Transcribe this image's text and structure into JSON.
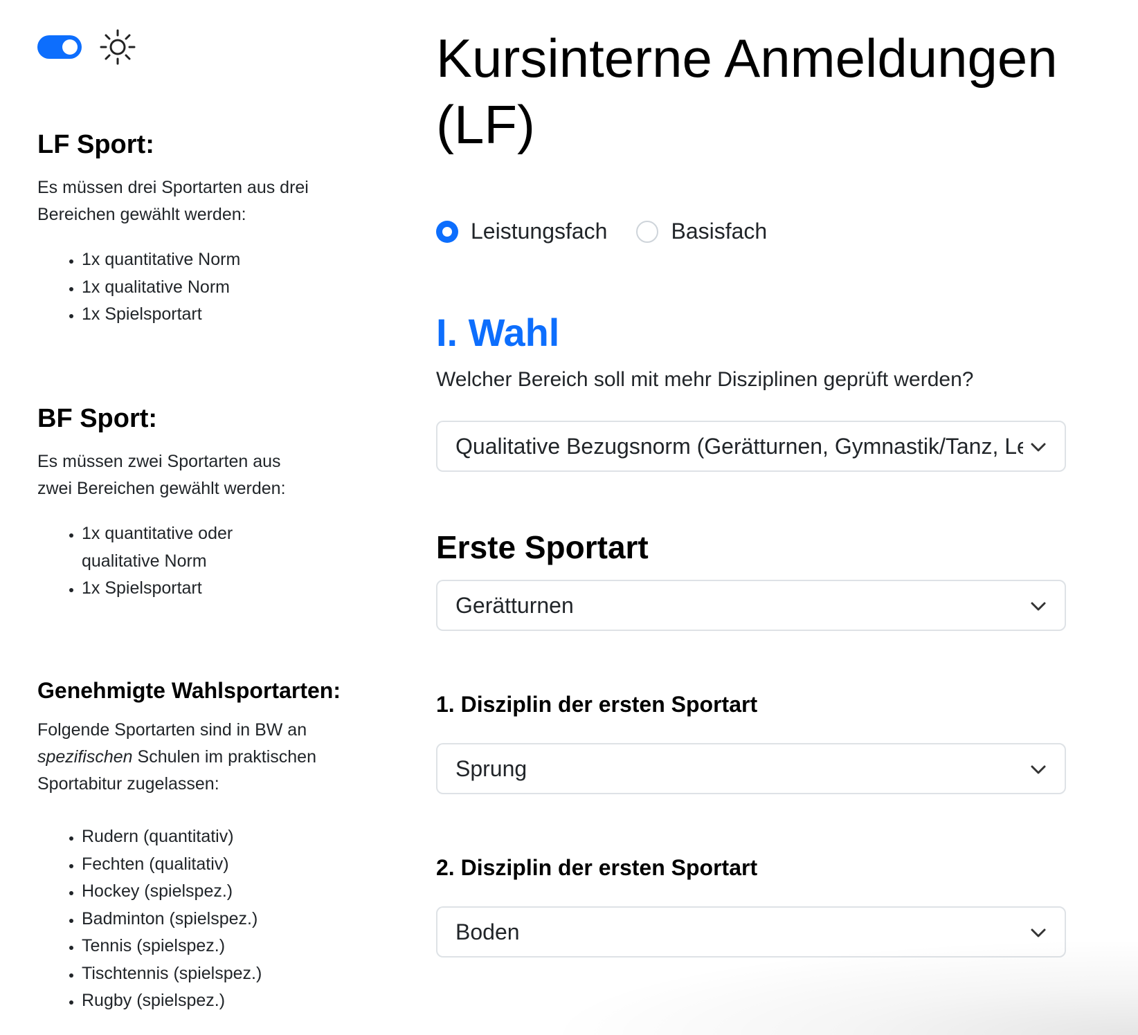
{
  "sidebar": {
    "theme_toggle": {
      "state": "on",
      "icon": "sun-icon"
    },
    "lf": {
      "heading": "LF Sport:",
      "text": "Es müssen drei Sportarten aus drei Bereichen gewählt werden:",
      "items": [
        "1x quantitative Norm",
        "1x qualitative Norm",
        "1x Spielsportart"
      ]
    },
    "bf": {
      "heading": "BF Sport:",
      "text": "Es müssen zwei Sportarten aus zwei Bereichen gewählt werden:",
      "items": [
        "1x quantitative oder qualitative Norm",
        "1x Spielsportart"
      ]
    },
    "genehmigt": {
      "heading": "Genehmigte Wahlsportarten:",
      "text_before": "Folgende Sportarten sind in BW an ",
      "text_em": "spezifischen",
      "text_after": " Schulen im praktischen Sportabitur zugelassen:",
      "items": [
        "Rudern (quantitativ)",
        "Fechten (qualitativ)",
        "Hockey (spielspez.)",
        "Badminton (spielspez.)",
        "Tennis (spielspez.)",
        "Tischtennis (spielspez.)",
        "Rugby (spielspez.)"
      ]
    }
  },
  "main": {
    "title": "Kursinterne Anmeldungen (LF)",
    "radios": [
      {
        "label": "Leistungsfach",
        "checked": true
      },
      {
        "label": "Basisfach",
        "checked": false
      }
    ],
    "wahl_title": "I. Wahl",
    "question": "Welcher Bereich soll mit mehr Disziplinen geprüft werden?",
    "bereich_select": "Qualitative Bezugsnorm (Gerätturnen, Gymnastik/Tanz, Leichtathletik)",
    "erste_sportart": {
      "heading": "Erste Sportart",
      "value": "Gerätturnen"
    },
    "disziplin1": {
      "heading": "1. Disziplin der ersten Sportart",
      "value": "Sprung"
    },
    "disziplin2": {
      "heading": "2. Disziplin der ersten Sportart",
      "value": "Boden"
    }
  },
  "colors": {
    "accent": "#0d6efd",
    "text": "#212529",
    "border": "#dee2e6"
  }
}
